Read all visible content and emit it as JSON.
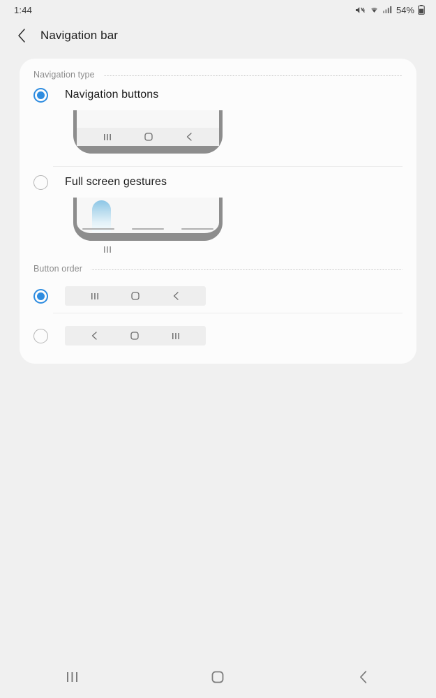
{
  "status_bar": {
    "clock": "1:44",
    "battery_percent": "54%",
    "icons": [
      "mute-icon",
      "wifi-icon",
      "signal-icon",
      "battery-icon"
    ]
  },
  "header": {
    "back_icon": "chevron-left-icon",
    "title": "Navigation bar"
  },
  "sections": {
    "navigation_type": {
      "label": "Navigation type",
      "options": [
        {
          "label": "Navigation buttons",
          "selected": true,
          "preview_icons": [
            "recents-icon",
            "home-icon",
            "back-icon"
          ]
        },
        {
          "label": "Full screen gestures",
          "selected": false,
          "caption": "|||",
          "preview_icons": [
            "swipe-up-indicator",
            "gesture-hint-bar",
            "gesture-hint-bar",
            "gesture-hint-bar"
          ]
        }
      ]
    },
    "button_order": {
      "label": "Button order",
      "options": [
        {
          "selected": true,
          "icons": [
            "recents-icon",
            "home-icon",
            "back-icon"
          ]
        },
        {
          "selected": false,
          "icons": [
            "back-icon",
            "home-icon",
            "recents-icon"
          ]
        }
      ]
    }
  },
  "system_nav": {
    "buttons": [
      "recents-icon",
      "home-icon",
      "back-icon"
    ]
  },
  "colors": {
    "accent": "#2e8ce0",
    "background": "#f0f0f0",
    "card": "#fcfcfc",
    "text_primary": "#1d1d1d",
    "text_secondary": "#8c8c8c",
    "device_frame": "#8d8d8d"
  }
}
